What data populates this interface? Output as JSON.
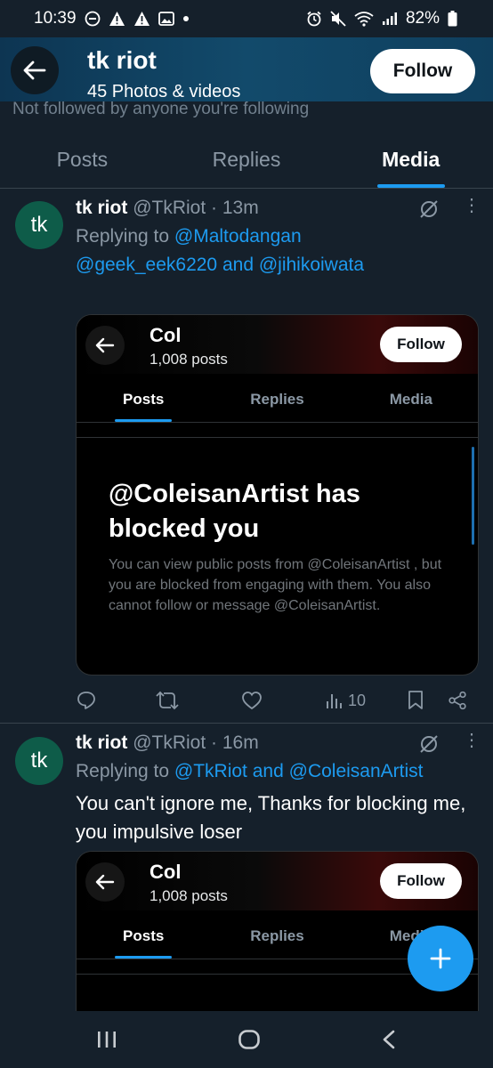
{
  "status_bar": {
    "time": "10:39",
    "battery": "82%"
  },
  "header": {
    "title": "tk riot",
    "subtitle": "45 Photos & videos",
    "follow_label": "Follow"
  },
  "not_followed_text": "Not followed by anyone you're following",
  "tabs": [
    {
      "label": "Posts",
      "active": false
    },
    {
      "label": "Replies",
      "active": false
    },
    {
      "label": "Media",
      "active": true
    }
  ],
  "posts": [
    {
      "avatar_text": "tk",
      "name": "tk riot",
      "handle": "@TkRiot",
      "time": "· 13m",
      "replying_prefix": "Replying to ",
      "replying_to_1": "@Maltodangan",
      "replying_line2_a": "@geek_eek6220",
      "replying_and": " and ",
      "replying_line2_b": "@jihikoiwata",
      "card": {
        "title": "Col",
        "subtitle": "1,008 posts",
        "follow_label": "Follow",
        "tabs": [
          "Posts",
          "Replies",
          "Media"
        ],
        "blocked_title": "@ColeisanArtist has blocked you",
        "blocked_body": "You can view public posts from @ColeisanArtist , but you are blocked from engaging with them. You also cannot follow or message @ColeisanArtist."
      },
      "views": "10"
    },
    {
      "avatar_text": "tk",
      "name": "tk riot",
      "handle": "@TkRiot",
      "time": "· 16m",
      "replying_prefix": "Replying to ",
      "replying_to_1": "@TkRiot",
      "replying_and": " and ",
      "replying_to_2": "@ColeisanArtist",
      "text": "You can't ignore me, Thanks for blocking me, you impulsive loser",
      "card": {
        "title": "Col",
        "subtitle": "1,008 posts",
        "follow_label": "Follow",
        "tabs": [
          "Posts",
          "Replies",
          "Media"
        ]
      }
    }
  ],
  "colors": {
    "accent": "#1d9bf0",
    "background": "#15202b",
    "avatar": "#0e5c49"
  },
  "icons": [
    "back-arrow-icon",
    "mute-icon",
    "more-icon",
    "reply-icon",
    "repost-icon",
    "like-icon",
    "views-icon",
    "bookmark-icon",
    "share-icon",
    "compose-plus-icon"
  ]
}
